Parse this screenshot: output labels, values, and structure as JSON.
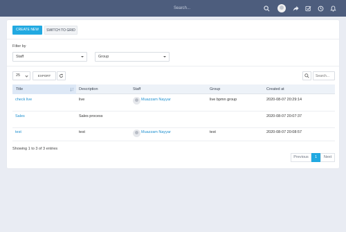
{
  "topbar": {
    "search_placeholder": "Search...",
    "icons": [
      "search-icon",
      "avatar",
      "share-icon",
      "tasks-icon",
      "clock-icon",
      "bell-icon"
    ]
  },
  "toolbar": {
    "create_label": "CREATE NEW",
    "grid_label": "SWITCH TO GRID"
  },
  "filters": {
    "label": "Filter by",
    "staff": "Staff",
    "group": "Group"
  },
  "table_controls": {
    "page_length": "25",
    "export_label": "EXPORT",
    "search_placeholder": "Search..."
  },
  "table": {
    "columns": [
      "Title",
      "Description",
      "Staff",
      "Group",
      "Created at"
    ],
    "rows": [
      {
        "title": "check live",
        "description": "live",
        "staff": "Muazzam Nayyar",
        "group": "live bpmn group",
        "created": "2020-08-07 20:29:14"
      },
      {
        "title": "Sales",
        "description": "Sales process",
        "staff": "",
        "group": "",
        "created": "2020-08-07 20:07:37"
      },
      {
        "title": "test",
        "description": "test",
        "staff": "Muazzam Nayyar",
        "group": "test",
        "created": "2020-08-07 20:08:57"
      }
    ]
  },
  "footer": {
    "info": "Showing 1 to 3 of 3 entries",
    "previous": "Previous",
    "page": "1",
    "next": "Next"
  },
  "colors": {
    "topbar": "#4d5d7d",
    "accent": "#21a9e1",
    "link": "#1d8fcf",
    "background": "#e9ecf3"
  }
}
